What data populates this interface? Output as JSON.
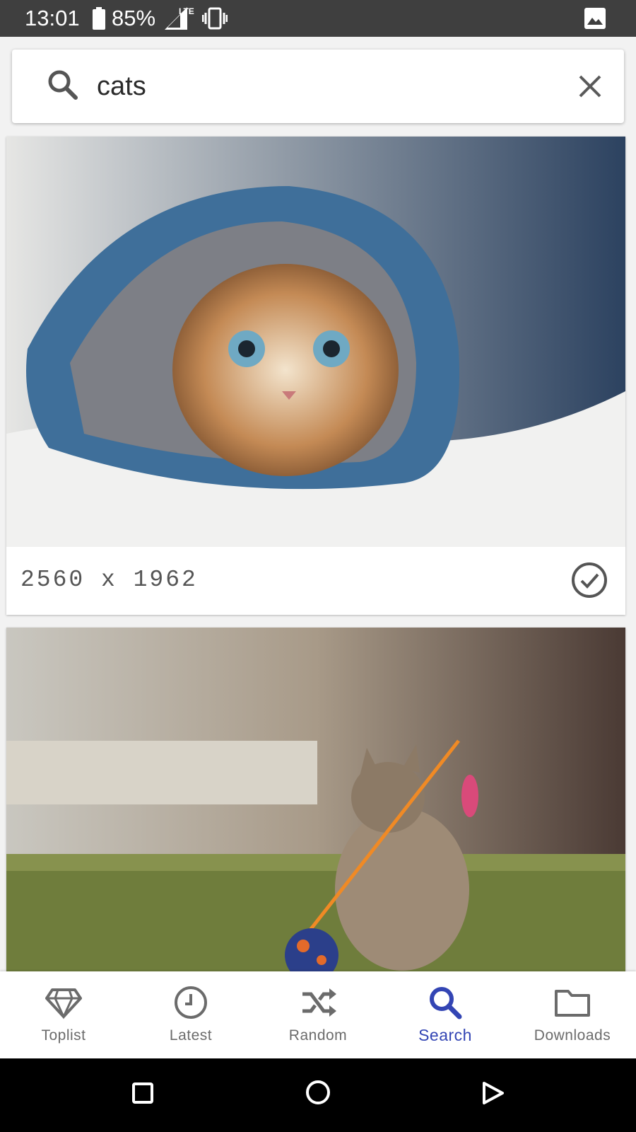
{
  "status_bar": {
    "time": "13:01",
    "battery_percent": "85%",
    "network_label": "LTE",
    "icons": [
      "battery-icon",
      "signal-icon",
      "vibrate-icon",
      "picture-icon"
    ]
  },
  "search": {
    "query": "cats",
    "icons": [
      "search-icon",
      "close-icon"
    ]
  },
  "results": [
    {
      "resolution": "2560 x 1962",
      "status_icon": "check-circle-icon"
    },
    {
      "resolution": ""
    }
  ],
  "bottom_nav": {
    "items": [
      {
        "label": "Toplist",
        "icon": "diamond-icon"
      },
      {
        "label": "Latest",
        "icon": "clock-icon"
      },
      {
        "label": "Random",
        "icon": "shuffle-icon"
      },
      {
        "label": "Search",
        "icon": "search-icon",
        "active": true
      },
      {
        "label": "Downloads",
        "icon": "folder-icon"
      }
    ],
    "active_color": "#3345b4",
    "inactive_color": "#6b6b6b"
  },
  "system_nav": [
    "recent-apps-icon",
    "home-icon",
    "back-icon"
  ]
}
